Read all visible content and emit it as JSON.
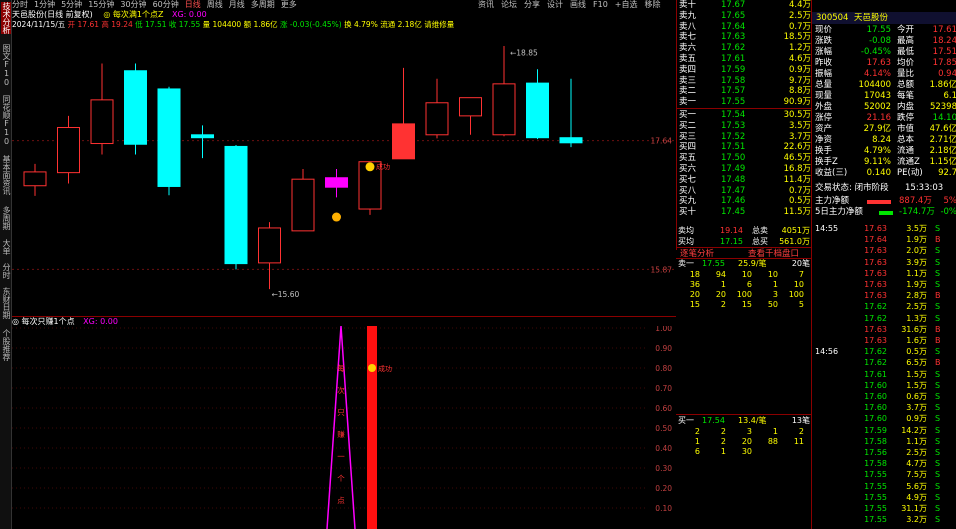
{
  "left_tabs": [
    "技术分析",
    "图文F10",
    "同花顺F10",
    "基本面资讯",
    "多周期",
    "大单",
    "分时",
    "东财日期",
    "个股推荐"
  ],
  "period_bar": [
    "分时",
    "1分钟",
    "5分钟",
    "15分钟",
    "30分钟",
    "60分钟",
    "日线",
    "周线",
    "月线",
    "多周期",
    "更多"
  ],
  "top_menu": [
    "资讯",
    "论坛",
    "分享",
    "设计",
    "画线",
    "F10",
    "+自选",
    "移除"
  ],
  "info_bar": {
    "name": "天邑股份(日线 前复权)",
    "indicator": "◎ 每次满1个点Z",
    "val": "XG: 0.00"
  },
  "legend_bar": {
    "date": "2024/11/15/五",
    "open": "开 17.61",
    "high": "高 19.24",
    "low": "低 17.51",
    "close": "收 17.55",
    "vol": "量 104400",
    "amount": "额 1.86亿",
    "change": "涨 -0.03(-0.45%)",
    "turnover": "换 4.79%",
    "float": "流通 2.18亿",
    "note": "请维修量"
  },
  "chart_data": {
    "type": "candlestick",
    "candles": [
      {
        "o": 17.02,
        "h": 17.32,
        "l": 16.88,
        "c": 17.21
      },
      {
        "o": 17.2,
        "h": 17.98,
        "l": 17.05,
        "c": 17.82
      },
      {
        "o": 17.6,
        "h": 18.7,
        "l": 17.45,
        "c": 18.2
      },
      {
        "o": 18.6,
        "h": 18.7,
        "l": 17.45,
        "c": 17.59
      },
      {
        "o": 18.35,
        "h": 18.38,
        "l": 16.89,
        "c": 17.01
      },
      {
        "o": 17.72,
        "h": 17.85,
        "l": 17.4,
        "c": 17.68
      },
      {
        "o": 17.56,
        "h": 17.58,
        "l": 15.87,
        "c": 15.95
      },
      {
        "o": 15.96,
        "h": 16.52,
        "l": 15.6,
        "c": 16.44
      },
      {
        "o": 16.4,
        "h": 17.25,
        "l": 16.4,
        "c": 17.11
      },
      {
        "o": 17.13,
        "h": 17.25,
        "l": 16.86,
        "c": 17.0
      },
      {
        "o": 16.7,
        "h": 17.28,
        "l": 16.62,
        "c": 17.35
      },
      {
        "o": 17.39,
        "h": 18.64,
        "l": 17.39,
        "c": 17.87
      },
      {
        "o": 17.72,
        "h": 18.49,
        "l": 17.67,
        "c": 18.16
      },
      {
        "o": 17.98,
        "h": 18.21,
        "l": 17.72,
        "c": 18.23
      },
      {
        "o": 17.72,
        "h": 18.94,
        "l": 17.7,
        "c": 18.42
      },
      {
        "o": 18.43,
        "h": 18.62,
        "l": 17.66,
        "c": 17.68
      },
      {
        "o": 17.68,
        "h": 18.49,
        "l": 17.55,
        "c": 17.61
      }
    ],
    "price_marks": [
      "18.85",
      "15.60"
    ],
    "axis_ticks": [
      "17.64",
      "15.87"
    ],
    "signals": [
      {
        "index": 10,
        "type": "buy"
      },
      {
        "index": 11,
        "type": "success",
        "label": "成功"
      }
    ]
  },
  "sub": {
    "title": "◎ 每次只赚1个点",
    "val": "XG: 0.00",
    "ticks": [
      "1.00",
      "0.90",
      "0.80",
      "0.70",
      "0.60",
      "0.50",
      "0.40",
      "0.30",
      "0.20",
      "0.10"
    ],
    "vertical_text": [
      "每",
      "次",
      "只",
      "赚",
      "一",
      "个",
      "点"
    ],
    "success_label": "成功"
  },
  "book": {
    "sell": [
      {
        "l": "卖十",
        "p": "17.67",
        "v": "4.4万"
      },
      {
        "l": "卖九",
        "p": "17.65",
        "v": "2.5万"
      },
      {
        "l": "卖八",
        "p": "17.64",
        "v": "0.7万"
      },
      {
        "l": "卖七",
        "p": "17.63",
        "v": "18.5万"
      },
      {
        "l": "卖六",
        "p": "17.62",
        "v": "1.2万"
      },
      {
        "l": "卖五",
        "p": "17.61",
        "v": "4.6万"
      },
      {
        "l": "卖四",
        "p": "17.59",
        "v": "0.9万"
      },
      {
        "l": "卖三",
        "p": "17.58",
        "v": "9.7万"
      },
      {
        "l": "卖二",
        "p": "17.57",
        "v": "8.8万"
      },
      {
        "l": "卖一",
        "p": "17.55",
        "v": "90.9万"
      }
    ],
    "buy": [
      {
        "l": "买一",
        "p": "17.54",
        "v": "30.5万"
      },
      {
        "l": "买二",
        "p": "17.53",
        "v": "3.5万"
      },
      {
        "l": "买三",
        "p": "17.52",
        "v": "3.7万"
      },
      {
        "l": "买四",
        "p": "17.51",
        "v": "22.6万"
      },
      {
        "l": "买五",
        "p": "17.50",
        "v": "46.5万"
      },
      {
        "l": "买六",
        "p": "17.49",
        "v": "16.8万"
      },
      {
        "l": "买七",
        "p": "17.48",
        "v": "11.4万"
      },
      {
        "l": "买八",
        "p": "17.47",
        "v": "0.7万"
      },
      {
        "l": "买九",
        "p": "17.46",
        "v": "0.5万"
      },
      {
        "l": "买十",
        "p": "17.45",
        "v": "11.5万"
      }
    ],
    "sum_sell": {
      "l": "卖均",
      "p": "19.14",
      "t": "总卖",
      "v": "4051万"
    },
    "sum_buy": {
      "l": "买均",
      "p": "17.15",
      "t": "总买",
      "v": "561.0万"
    },
    "btn_left": "逐笔分析",
    "btn_right": "查看千档盘口",
    "q_sell_head": {
      "l": "卖一",
      "p": "17.55",
      "v": "25.9/笔",
      "n": "20笔"
    },
    "q_sell_rows": [
      [
        "18",
        "94",
        "10",
        "10",
        "7"
      ],
      [
        "36",
        "1",
        "6",
        "1",
        "10"
      ],
      [
        "20",
        "20",
        "100",
        "3",
        "100"
      ],
      [
        "15",
        "2",
        "15",
        "50",
        "5"
      ]
    ],
    "q_buy_head": {
      "l": "买一",
      "p": "17.54",
      "v": "13.4/笔",
      "n": "13笔"
    },
    "q_buy_rows": [
      [
        "2",
        "2",
        "3",
        "1",
        "2"
      ],
      [
        "1",
        "2",
        "20",
        "88",
        "11"
      ],
      [
        "6",
        "1",
        "30",
        "",
        ""
      ]
    ]
  },
  "rp": {
    "code": "300504",
    "name": "天邑股份",
    "stats": [
      {
        "a": "现价",
        "b": "17.55",
        "c": "今开",
        "d": "17.61"
      },
      {
        "a": "涨跌",
        "b": "-0.08",
        "c": "最高",
        "d": "18.24"
      },
      {
        "a": "涨幅",
        "b": "-0.45%",
        "c": "最低",
        "d": "17.51"
      },
      {
        "a": "昨收",
        "b": "17.63",
        "c": "均价",
        "d": "17.85"
      },
      {
        "a": "振幅",
        "b": "4.14%",
        "c": "量比",
        "d": "0.94"
      },
      {
        "a": "总量",
        "b": "104400",
        "c": "总额",
        "d": "1.86亿"
      },
      {
        "a": "现量",
        "b": "17043",
        "c": "每笔",
        "d": "6.1"
      },
      {
        "a": "外盘",
        "b": "52002",
        "c": "内盘",
        "d": "52398"
      }
    ],
    "stats2": [
      {
        "a": "涨停",
        "b": "21.16",
        "c": "跌停",
        "d": "14.10"
      },
      {
        "a": "资产",
        "b": "27.9亿",
        "c": "市值",
        "d": "47.6亿"
      },
      {
        "a": "净资",
        "b": "8.24",
        "c": "总本",
        "d": "2.71亿"
      },
      {
        "a": "换手",
        "b": "4.79%",
        "c": "流通",
        "d": "2.18亿"
      },
      {
        "a": "换手Z",
        "b": "9.11%",
        "c": "流通Z",
        "d": "1.15亿"
      },
      {
        "a": "收益(三)",
        "b": "0.140",
        "c": "PE(动)",
        "d": "92.7"
      }
    ],
    "trade_state": "交易状态: 闭市阶段",
    "trade_time": "15:33:03",
    "main_flow_label": "主力净额",
    "main_flow_val": "887.4万",
    "main_flow_pct": "5%",
    "flow5_label": "5日主力净额",
    "flow5_val": "-174.7万",
    "flow5_pct": "-0%",
    "ticks": [
      {
        "t": "14:55",
        "p": "17.63",
        "v": "3.5万",
        "d": "S"
      },
      {
        "t": "",
        "p": "17.64",
        "v": "1.9万",
        "d": "B"
      },
      {
        "t": "",
        "p": "17.63",
        "v": "2.0万",
        "d": "S"
      },
      {
        "t": "",
        "p": "17.63",
        "v": "3.9万",
        "d": "S"
      },
      {
        "t": "",
        "p": "17.63",
        "v": "1.1万",
        "d": "S"
      },
      {
        "t": "",
        "p": "17.63",
        "v": "1.9万",
        "d": "S"
      },
      {
        "t": "",
        "p": "17.63",
        "v": "2.8万",
        "d": "B"
      },
      {
        "t": "",
        "p": "17.62",
        "v": "2.5万",
        "d": "S"
      },
      {
        "t": "",
        "p": "17.62",
        "v": "1.3万",
        "d": "S"
      },
      {
        "t": "",
        "p": "17.63",
        "v": "31.6万",
        "d": "B"
      },
      {
        "t": "",
        "p": "17.63",
        "v": "1.6万",
        "d": "B"
      },
      {
        "t": "14:56",
        "p": "17.62",
        "v": "0.5万",
        "d": "S"
      },
      {
        "t": "",
        "p": "17.62",
        "v": "6.5万",
        "d": "B"
      },
      {
        "t": "",
        "p": "17.61",
        "v": "1.5万",
        "d": "S"
      },
      {
        "t": "",
        "p": "17.60",
        "v": "1.5万",
        "d": "S"
      },
      {
        "t": "",
        "p": "17.60",
        "v": "0.6万",
        "d": "S"
      },
      {
        "t": "",
        "p": "17.60",
        "v": "3.7万",
        "d": "S"
      },
      {
        "t": "",
        "p": "17.60",
        "v": "0.9万",
        "d": "S"
      },
      {
        "t": "",
        "p": "17.59",
        "v": "14.2万",
        "d": "S"
      },
      {
        "t": "",
        "p": "17.58",
        "v": "1.1万",
        "d": "S"
      },
      {
        "t": "",
        "p": "17.56",
        "v": "2.5万",
        "d": "S"
      },
      {
        "t": "",
        "p": "17.58",
        "v": "4.7万",
        "d": "S"
      },
      {
        "t": "",
        "p": "17.55",
        "v": "7.5万",
        "d": "S"
      },
      {
        "t": "",
        "p": "17.55",
        "v": "5.6万",
        "d": "S"
      },
      {
        "t": "",
        "p": "17.55",
        "v": "4.9万",
        "d": "S"
      },
      {
        "t": "",
        "p": "17.55",
        "v": "31.1万",
        "d": "S"
      },
      {
        "t": "",
        "p": "17.55",
        "v": "3.2万",
        "d": "S"
      }
    ]
  },
  "colors": {
    "up": "#ff3232",
    "down": "#00ffff",
    "magenta": "#ff00ff",
    "grid": "#8b0000"
  }
}
